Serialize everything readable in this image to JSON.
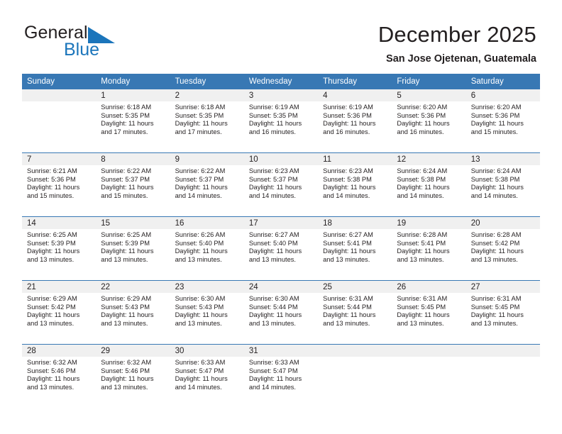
{
  "logo": {
    "word_general": "General",
    "word_blue": "Blue",
    "flag_icon": "triangle-flag-icon",
    "flag_color": "#1b75bb"
  },
  "header": {
    "month_title": "December 2025",
    "location": "San Jose Ojetenan, Guatemala"
  },
  "theme": {
    "header_blue": "#3878b4",
    "band_gray": "#f0f0f0",
    "text": "#231f20",
    "logo_blue": "#1b75bb"
  },
  "weekdays": [
    "Sunday",
    "Monday",
    "Tuesday",
    "Wednesday",
    "Thursday",
    "Friday",
    "Saturday"
  ],
  "weeks": [
    [
      {
        "day": "",
        "empty": true
      },
      {
        "day": "1",
        "sunrise": "Sunrise: 6:18 AM",
        "sunset": "Sunset: 5:35 PM",
        "daylight": "Daylight: 11 hours and 17 minutes."
      },
      {
        "day": "2",
        "sunrise": "Sunrise: 6:18 AM",
        "sunset": "Sunset: 5:35 PM",
        "daylight": "Daylight: 11 hours and 17 minutes."
      },
      {
        "day": "3",
        "sunrise": "Sunrise: 6:19 AM",
        "sunset": "Sunset: 5:35 PM",
        "daylight": "Daylight: 11 hours and 16 minutes."
      },
      {
        "day": "4",
        "sunrise": "Sunrise: 6:19 AM",
        "sunset": "Sunset: 5:36 PM",
        "daylight": "Daylight: 11 hours and 16 minutes."
      },
      {
        "day": "5",
        "sunrise": "Sunrise: 6:20 AM",
        "sunset": "Sunset: 5:36 PM",
        "daylight": "Daylight: 11 hours and 16 minutes."
      },
      {
        "day": "6",
        "sunrise": "Sunrise: 6:20 AM",
        "sunset": "Sunset: 5:36 PM",
        "daylight": "Daylight: 11 hours and 15 minutes."
      }
    ],
    [
      {
        "day": "7",
        "sunrise": "Sunrise: 6:21 AM",
        "sunset": "Sunset: 5:36 PM",
        "daylight": "Daylight: 11 hours and 15 minutes."
      },
      {
        "day": "8",
        "sunrise": "Sunrise: 6:22 AM",
        "sunset": "Sunset: 5:37 PM",
        "daylight": "Daylight: 11 hours and 15 minutes."
      },
      {
        "day": "9",
        "sunrise": "Sunrise: 6:22 AM",
        "sunset": "Sunset: 5:37 PM",
        "daylight": "Daylight: 11 hours and 14 minutes."
      },
      {
        "day": "10",
        "sunrise": "Sunrise: 6:23 AM",
        "sunset": "Sunset: 5:37 PM",
        "daylight": "Daylight: 11 hours and 14 minutes."
      },
      {
        "day": "11",
        "sunrise": "Sunrise: 6:23 AM",
        "sunset": "Sunset: 5:38 PM",
        "daylight": "Daylight: 11 hours and 14 minutes."
      },
      {
        "day": "12",
        "sunrise": "Sunrise: 6:24 AM",
        "sunset": "Sunset: 5:38 PM",
        "daylight": "Daylight: 11 hours and 14 minutes."
      },
      {
        "day": "13",
        "sunrise": "Sunrise: 6:24 AM",
        "sunset": "Sunset: 5:38 PM",
        "daylight": "Daylight: 11 hours and 14 minutes."
      }
    ],
    [
      {
        "day": "14",
        "sunrise": "Sunrise: 6:25 AM",
        "sunset": "Sunset: 5:39 PM",
        "daylight": "Daylight: 11 hours and 13 minutes."
      },
      {
        "day": "15",
        "sunrise": "Sunrise: 6:25 AM",
        "sunset": "Sunset: 5:39 PM",
        "daylight": "Daylight: 11 hours and 13 minutes."
      },
      {
        "day": "16",
        "sunrise": "Sunrise: 6:26 AM",
        "sunset": "Sunset: 5:40 PM",
        "daylight": "Daylight: 11 hours and 13 minutes."
      },
      {
        "day": "17",
        "sunrise": "Sunrise: 6:27 AM",
        "sunset": "Sunset: 5:40 PM",
        "daylight": "Daylight: 11 hours and 13 minutes."
      },
      {
        "day": "18",
        "sunrise": "Sunrise: 6:27 AM",
        "sunset": "Sunset: 5:41 PM",
        "daylight": "Daylight: 11 hours and 13 minutes."
      },
      {
        "day": "19",
        "sunrise": "Sunrise: 6:28 AM",
        "sunset": "Sunset: 5:41 PM",
        "daylight": "Daylight: 11 hours and 13 minutes."
      },
      {
        "day": "20",
        "sunrise": "Sunrise: 6:28 AM",
        "sunset": "Sunset: 5:42 PM",
        "daylight": "Daylight: 11 hours and 13 minutes."
      }
    ],
    [
      {
        "day": "21",
        "sunrise": "Sunrise: 6:29 AM",
        "sunset": "Sunset: 5:42 PM",
        "daylight": "Daylight: 11 hours and 13 minutes."
      },
      {
        "day": "22",
        "sunrise": "Sunrise: 6:29 AM",
        "sunset": "Sunset: 5:43 PM",
        "daylight": "Daylight: 11 hours and 13 minutes."
      },
      {
        "day": "23",
        "sunrise": "Sunrise: 6:30 AM",
        "sunset": "Sunset: 5:43 PM",
        "daylight": "Daylight: 11 hours and 13 minutes."
      },
      {
        "day": "24",
        "sunrise": "Sunrise: 6:30 AM",
        "sunset": "Sunset: 5:44 PM",
        "daylight": "Daylight: 11 hours and 13 minutes."
      },
      {
        "day": "25",
        "sunrise": "Sunrise: 6:31 AM",
        "sunset": "Sunset: 5:44 PM",
        "daylight": "Daylight: 11 hours and 13 minutes."
      },
      {
        "day": "26",
        "sunrise": "Sunrise: 6:31 AM",
        "sunset": "Sunset: 5:45 PM",
        "daylight": "Daylight: 11 hours and 13 minutes."
      },
      {
        "day": "27",
        "sunrise": "Sunrise: 6:31 AM",
        "sunset": "Sunset: 5:45 PM",
        "daylight": "Daylight: 11 hours and 13 minutes."
      }
    ],
    [
      {
        "day": "28",
        "sunrise": "Sunrise: 6:32 AM",
        "sunset": "Sunset: 5:46 PM",
        "daylight": "Daylight: 11 hours and 13 minutes."
      },
      {
        "day": "29",
        "sunrise": "Sunrise: 6:32 AM",
        "sunset": "Sunset: 5:46 PM",
        "daylight": "Daylight: 11 hours and 13 minutes."
      },
      {
        "day": "30",
        "sunrise": "Sunrise: 6:33 AM",
        "sunset": "Sunset: 5:47 PM",
        "daylight": "Daylight: 11 hours and 14 minutes."
      },
      {
        "day": "31",
        "sunrise": "Sunrise: 6:33 AM",
        "sunset": "Sunset: 5:47 PM",
        "daylight": "Daylight: 11 hours and 14 minutes."
      },
      {
        "day": "",
        "empty": true
      },
      {
        "day": "",
        "empty": true
      },
      {
        "day": "",
        "empty": true
      }
    ]
  ]
}
